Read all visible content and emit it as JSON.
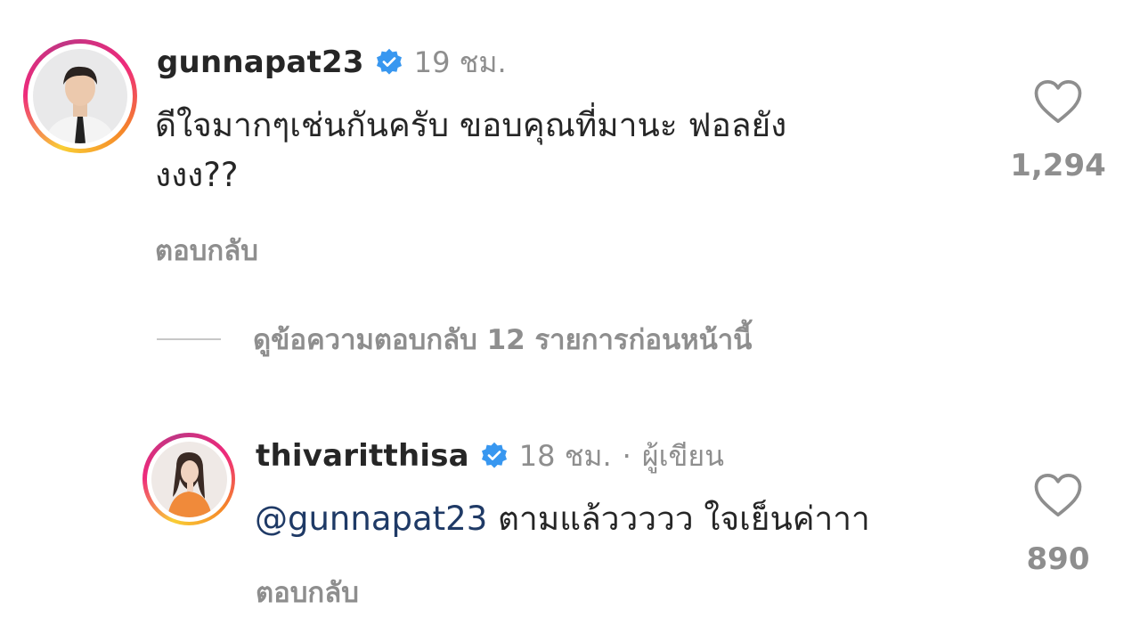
{
  "comment": {
    "username": "gunnapat23",
    "time": "19 ชม.",
    "text_line1": "ดีใจมากๆเช่นกันครับ ขอบคุณที่มานะ ฟอลยัง",
    "text_line2": "งงง??",
    "reply_label": "ตอบกลับ",
    "likes": "1,294",
    "avatar_icon": "person-avatar-icon"
  },
  "view_replies": {
    "label": "ดูข้อความตอบกลับ 12 รายการก่อนหน้านี้"
  },
  "reply": {
    "username": "thivaritthisa",
    "time": "18 ชม.",
    "separator": "·",
    "author_badge": "ผู้เขียน",
    "mention": "@gunnapat23",
    "text": " ตามแล้ววววว ใจเย็นค่าาา",
    "reply_label": "ตอบกลับ",
    "likes": "890",
    "avatar_icon": "person-avatar-icon"
  },
  "colors": {
    "verified": "#3897f0",
    "secondary_text": "#8e8e8e",
    "mention": "#1f3a66"
  }
}
